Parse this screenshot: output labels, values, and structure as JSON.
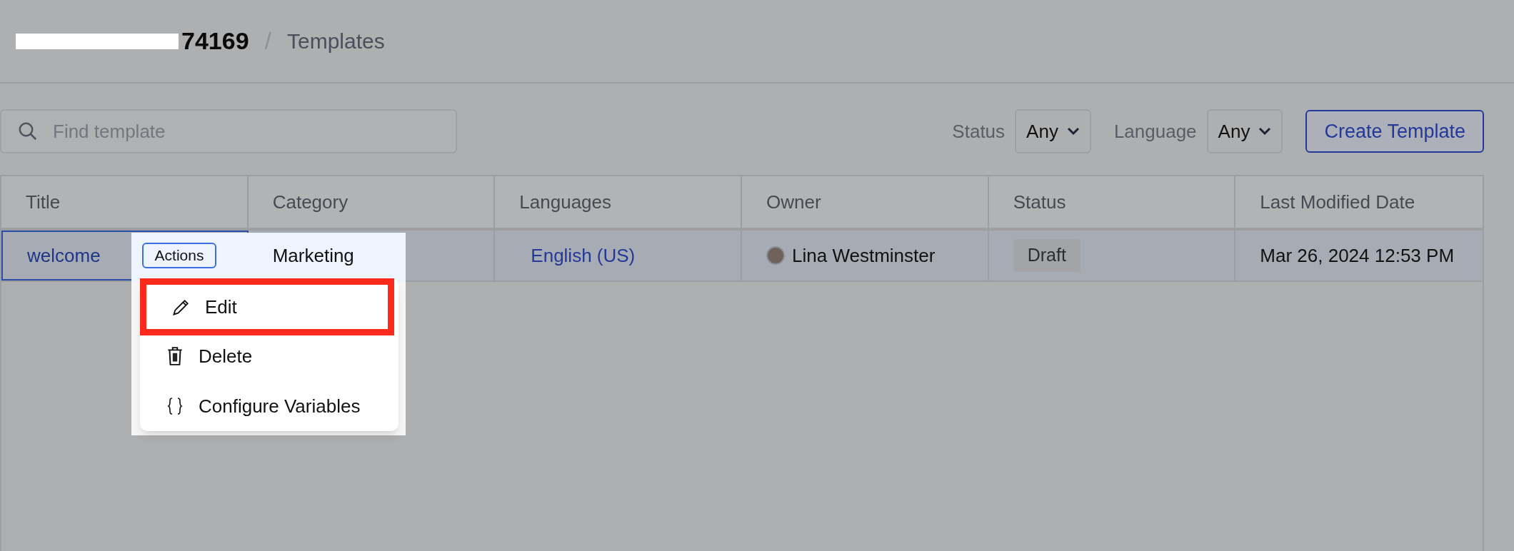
{
  "header": {
    "title": "74169",
    "separator": "/",
    "section": "Templates"
  },
  "search": {
    "placeholder": "Find template"
  },
  "filters": [
    {
      "label": "Status",
      "value": "Any"
    },
    {
      "label": "Language",
      "value": "Any"
    }
  ],
  "create_button": "Create Template",
  "table": {
    "columns": [
      "Title",
      "Category",
      "Languages",
      "Owner",
      "Status",
      "Last Modified Date"
    ],
    "rows": [
      {
        "title": "welcome",
        "selected": true,
        "actions": "Actions",
        "category": "Marketing",
        "language": "English (US)",
        "owner": "Lina Westminster",
        "status": "Draft",
        "last_modified": "Mar 26, 2024 12:53 PM"
      }
    ]
  },
  "menu": {
    "items": [
      {
        "kind": "edit",
        "label": "Edit",
        "highlighted": true
      },
      {
        "kind": "delete",
        "label": "Delete",
        "highlighted": false
      },
      {
        "kind": "variables",
        "label": "Configure Variables",
        "highlighted": false
      }
    ]
  }
}
